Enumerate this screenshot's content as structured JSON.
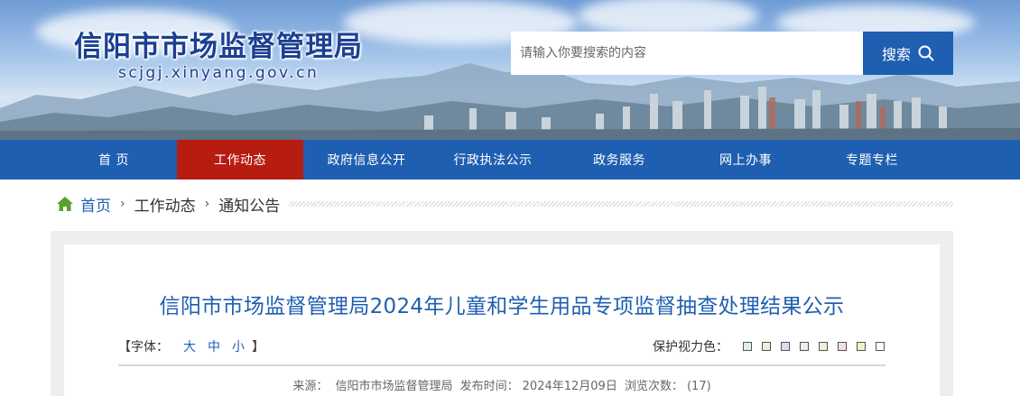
{
  "header": {
    "site_title": "信阳市市场监督管理局",
    "site_domain": "scjgj.xinyang.gov.cn",
    "search": {
      "placeholder": "请输入你要搜索的内容",
      "button_label": "搜索"
    }
  },
  "nav": {
    "items": [
      {
        "label": "首 页"
      },
      {
        "label": "工作动态",
        "active": true
      },
      {
        "label": "政府信息公开"
      },
      {
        "label": "行政执法公示"
      },
      {
        "label": "政务服务"
      },
      {
        "label": "网上办事"
      },
      {
        "label": "专题专栏"
      }
    ]
  },
  "breadcrumb": {
    "home": "首页",
    "level1": "工作动态",
    "level2": "通知公告"
  },
  "article": {
    "title": "信阳市市场监督管理局2024年儿童和学生用品专项监督抽查处理结果公示",
    "font_label": "【字体：",
    "font_large": "大",
    "font_medium": "中",
    "font_small": "小",
    "font_close": "】",
    "eye_label": "保护视力色：",
    "eye_colors": [
      "#dfeee9",
      "#e8f3d5",
      "#dadef0",
      "#eeeeee",
      "#f3ecd7",
      "#f5dfdc",
      "#eef2cc",
      "#ffffff"
    ],
    "source_label": "来源：",
    "source_value": "信阳市市场监督管理局",
    "date_label": "发布时间：",
    "date_value": "2024年12月09日",
    "views_label": "浏览次数：",
    "views_value": "(17)"
  },
  "colors": {
    "brand_blue": "#1f5fb1",
    "active_red": "#b71c10",
    "title_blue": "#1b3f92"
  }
}
